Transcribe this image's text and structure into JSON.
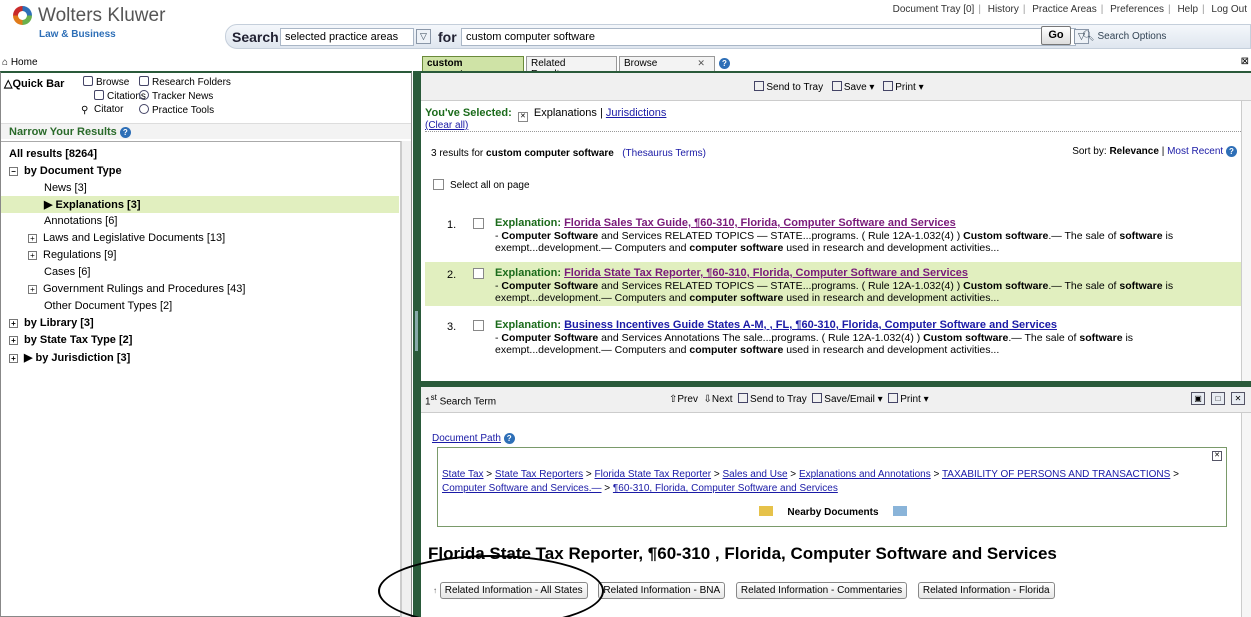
{
  "header": {
    "brand": "Wolters Kluwer",
    "brand_sub": "Law & Business",
    "top_links": [
      "Document Tray [0]",
      "History",
      "Practice Areas",
      "Preferences",
      "Help",
      "Log Out"
    ],
    "search_label": "Search",
    "search_scope": "selected practice areas",
    "for_label": "for",
    "search_query": "custom computer software",
    "go_label": "Go",
    "search_options": "Search Options"
  },
  "home_label": "Home",
  "tabs": [
    {
      "label": "custom comput..."
    },
    {
      "label": "Related Results"
    },
    {
      "label": "Browse"
    }
  ],
  "quickbar": {
    "title": "Quick Bar",
    "items": [
      "Browse",
      "Research Folders",
      "Citations",
      "Tracker News",
      "Citator",
      "Practice Tools"
    ]
  },
  "narrow": {
    "title": "Narrow Your Results",
    "all_results": "All results [8264]",
    "by_doc_type": "by Document Type",
    "doc_types": [
      "News [3]",
      "Explanations [3]",
      "Annotations [6]",
      "Laws and Legislative Documents [13]",
      "Regulations [9]",
      "Cases [6]",
      "Government Rulings and Procedures [43]",
      "Other Document Types [2]"
    ],
    "groups": [
      "by Library [3]",
      "by State Tax Type [2]",
      "by Jurisdiction [3]"
    ]
  },
  "results": {
    "toolbar": [
      "Send to Tray",
      "Save",
      "Print"
    ],
    "selected_label": "You've Selected:",
    "selected_items": [
      "Explanations",
      "Jurisdictions"
    ],
    "clear_all": "(Clear all)",
    "count_text": "3 results for",
    "count_query": "custom computer software",
    "thesaurus": "(Thesaurus Terms)",
    "sort_label": "Sort by:",
    "sort_relevance": "Relevance",
    "sort_recent": "Most Recent",
    "select_all": "Select all on page",
    "items": [
      {
        "num": "1.",
        "prefix": "Explanation:",
        "title": "Florida Sales Tax Guide, ¶60-310, Florida, Computer Software and Services"
      },
      {
        "num": "2.",
        "prefix": "Explanation:",
        "title": "Florida State Tax Reporter, ¶60-310, Florida, Computer Software and Services"
      },
      {
        "num": "3.",
        "prefix": "Explanation:",
        "title": "Business Incentives Guide States A-M, , FL, ¶60-310, Florida, Computer Software and Services"
      }
    ]
  },
  "doc": {
    "term_label": "Search Term",
    "term_ord": "1",
    "term_sup": "st",
    "toolbar": [
      "Prev",
      "Next",
      "Send to Tray",
      "Save/Email",
      "Print"
    ],
    "doc_path": "Document Path",
    "crumbs": [
      "State Tax",
      "State Tax Reporters",
      "Florida State Tax Reporter",
      "Sales and Use",
      "Explanations and Annotations",
      "TAXABILITY OF PERSONS AND TRANSACTIONS",
      "Computer Software and Services.—",
      "¶60-310, Florida, Computer Software and Services"
    ],
    "nearby": "Nearby Documents",
    "title": "Florida State Tax Reporter, ¶60-310 , Florida, Computer Software and Services",
    "related": [
      "Related Information - All States",
      "Related Information - BNA",
      "Related Information - Commentaries",
      "Related Information - Florida"
    ]
  }
}
